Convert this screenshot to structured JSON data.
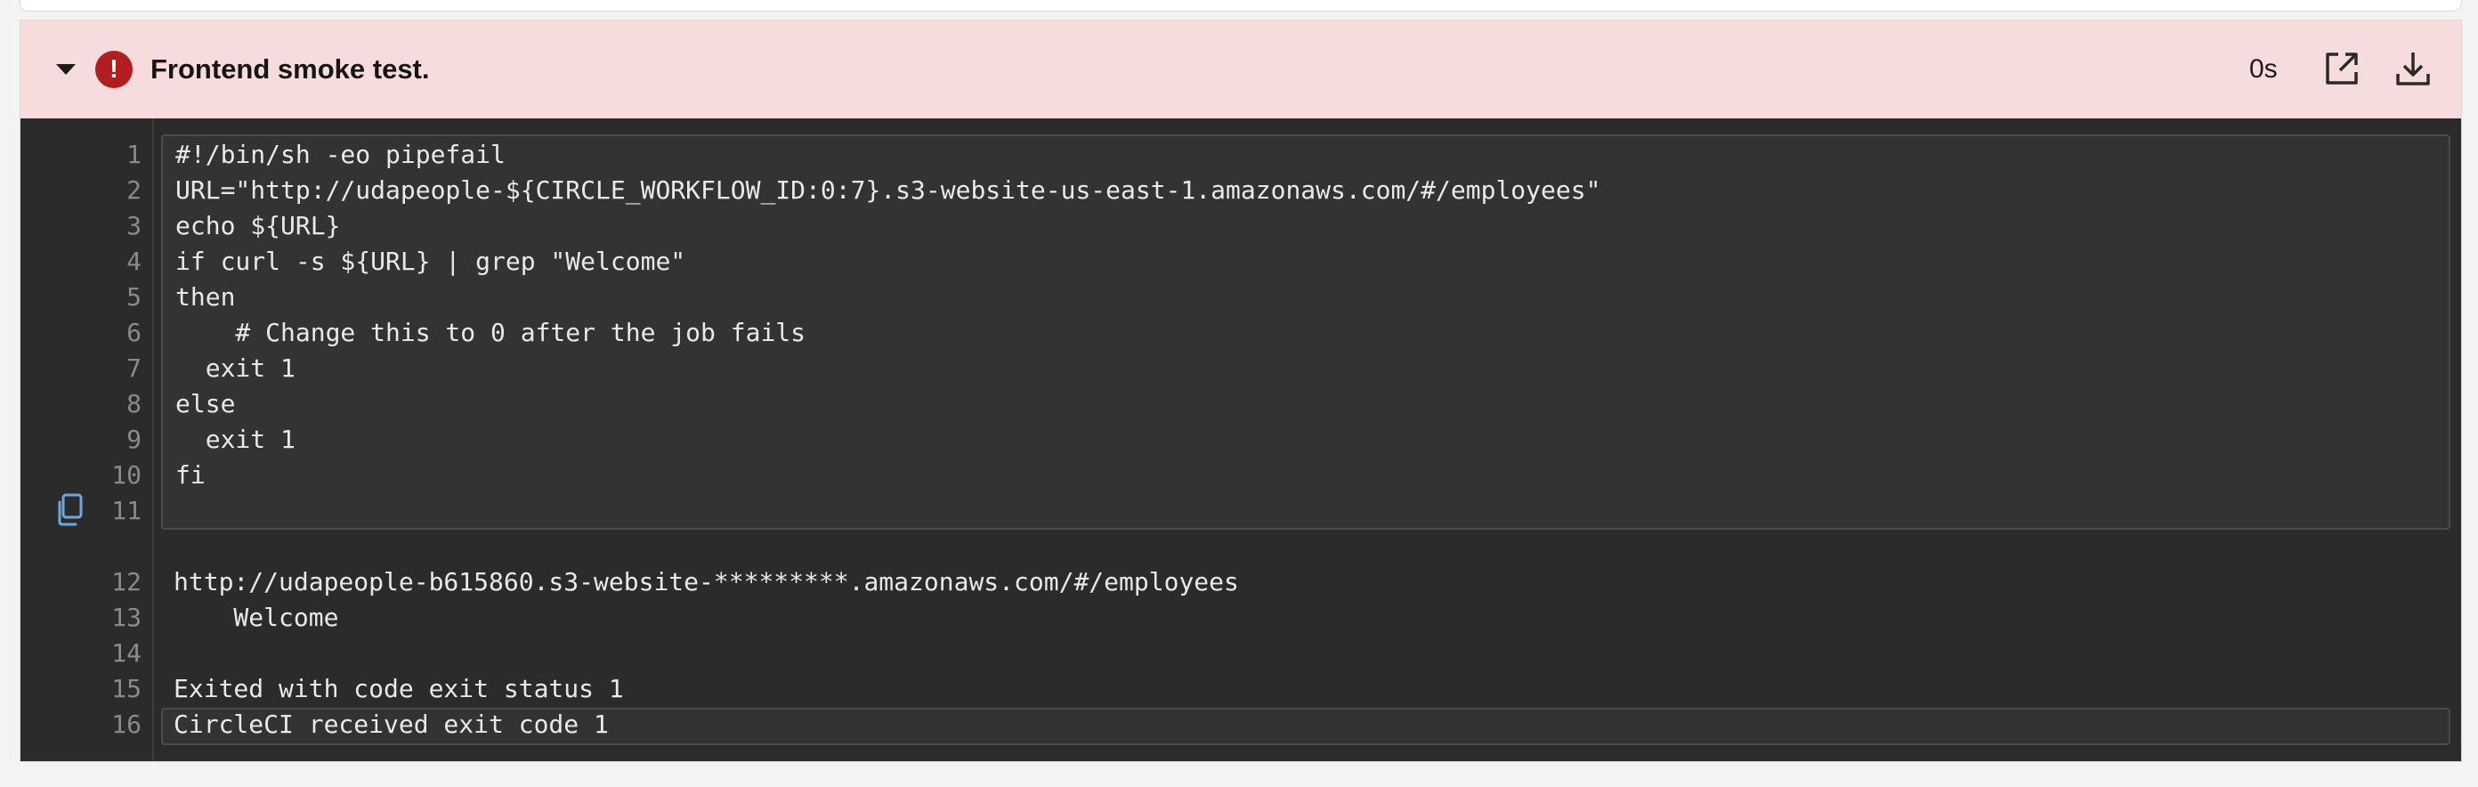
{
  "step": {
    "title": "Frontend smoke test.",
    "status": "failed",
    "duration": "0s",
    "status_icon": "!"
  },
  "icons": {
    "caret": "caret-down-icon",
    "status": "error-circle-icon",
    "open": "open-external-icon",
    "download": "download-icon",
    "copy": "copy-icon"
  },
  "colors": {
    "header_bg": "#f6dcdd",
    "error_red": "#b31d1f",
    "terminal_bg": "#2b2b2b",
    "copy_icon": "#6fa8dc"
  },
  "command": {
    "lines": [
      {
        "num": "1",
        "text": "#!/bin/sh -eo pipefail"
      },
      {
        "num": "2",
        "text": "URL=\"http://udapeople-${CIRCLE_WORKFLOW_ID:0:7}.s3-website-us-east-1.amazonaws.com/#/employees\""
      },
      {
        "num": "3",
        "text": "echo ${URL}"
      },
      {
        "num": "4",
        "text": "if curl -s ${URL} | grep \"Welcome\""
      },
      {
        "num": "5",
        "text": "then"
      },
      {
        "num": "6",
        "text": "    # Change this to 0 after the job fails"
      },
      {
        "num": "7",
        "text": "  exit 1"
      },
      {
        "num": "8",
        "text": "else"
      },
      {
        "num": "9",
        "text": "  exit 1"
      },
      {
        "num": "10",
        "text": "fi"
      },
      {
        "num": "11",
        "text": ""
      }
    ]
  },
  "output": {
    "lines": [
      {
        "num": "12",
        "text": "http://udapeople-b615860.s3-website-*********.amazonaws.com/#/employees"
      },
      {
        "num": "13",
        "text": "    Welcome"
      },
      {
        "num": "14",
        "text": ""
      },
      {
        "num": "15",
        "text": "Exited with code exit status 1"
      },
      {
        "num": "16",
        "text": "CircleCI received exit code 1"
      }
    ]
  }
}
